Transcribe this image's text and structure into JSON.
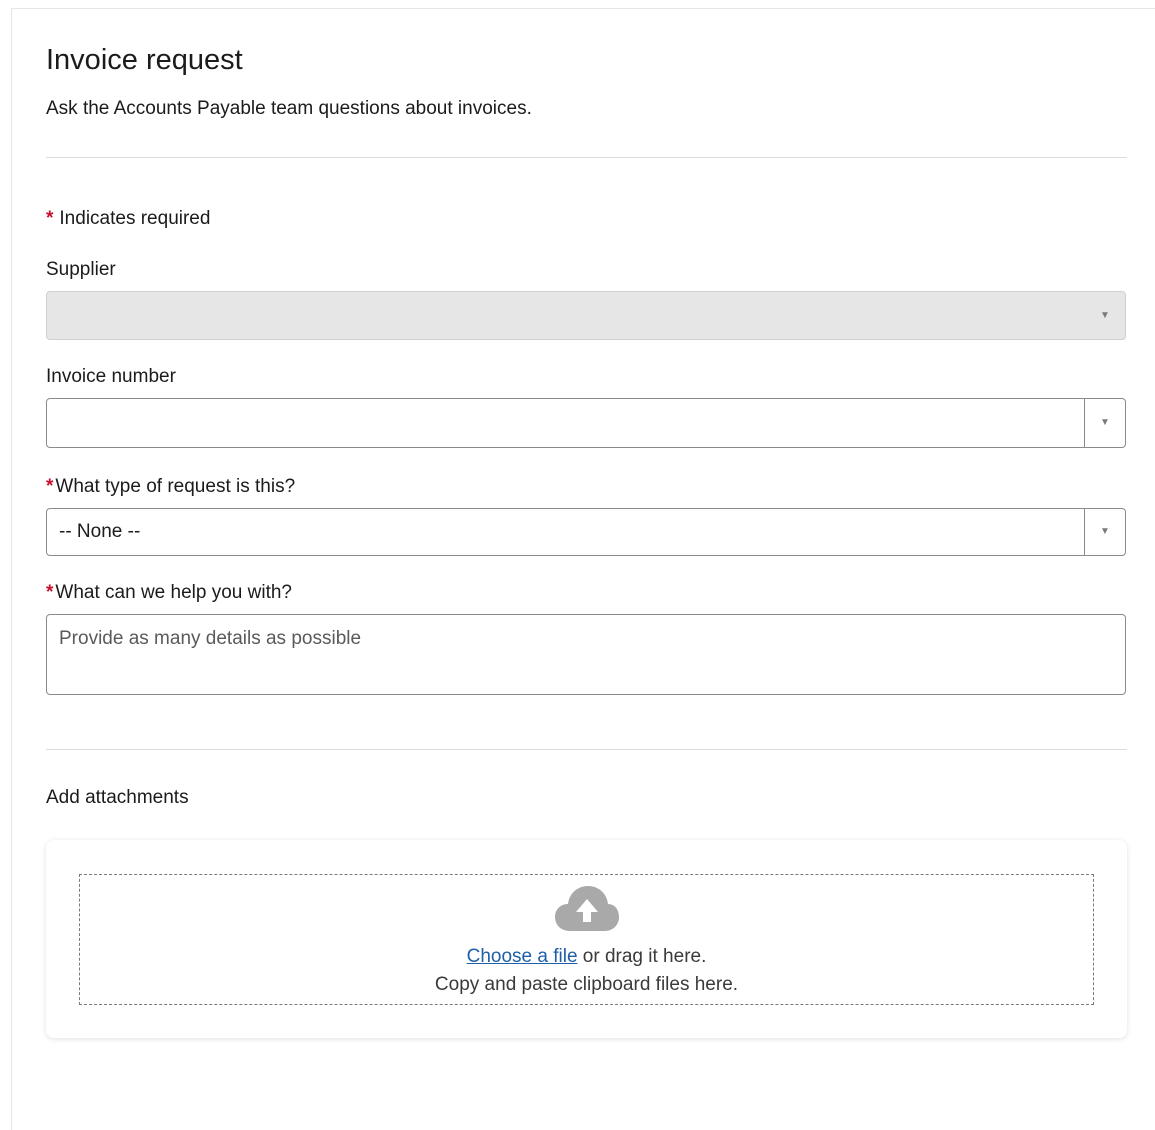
{
  "form": {
    "title": "Invoice request",
    "subtitle": "Ask the Accounts Payable team questions about invoices.",
    "required_marker": "*",
    "required_note": "Indicates required"
  },
  "fields": {
    "supplier": {
      "label": "Supplier",
      "value": "",
      "disabled": true
    },
    "invoice_number": {
      "label": "Invoice number",
      "value": ""
    },
    "request_type": {
      "label": "What type of request is this?",
      "required": true,
      "value": "-- None --"
    },
    "help": {
      "label": "What can we help you with?",
      "required": true,
      "placeholder": "Provide as many details as possible"
    }
  },
  "attachments": {
    "label": "Add attachments",
    "choose_link": "Choose a file",
    "drag_text": "or drag it here.",
    "paste_text": "Copy and paste clipboard files here.",
    "icon": "cloud-upload-icon"
  },
  "colors": {
    "required": "#c8102e",
    "link": "#1f5fa8",
    "disabled_field": "#e6e6e6",
    "border": "#8a8a8a"
  }
}
